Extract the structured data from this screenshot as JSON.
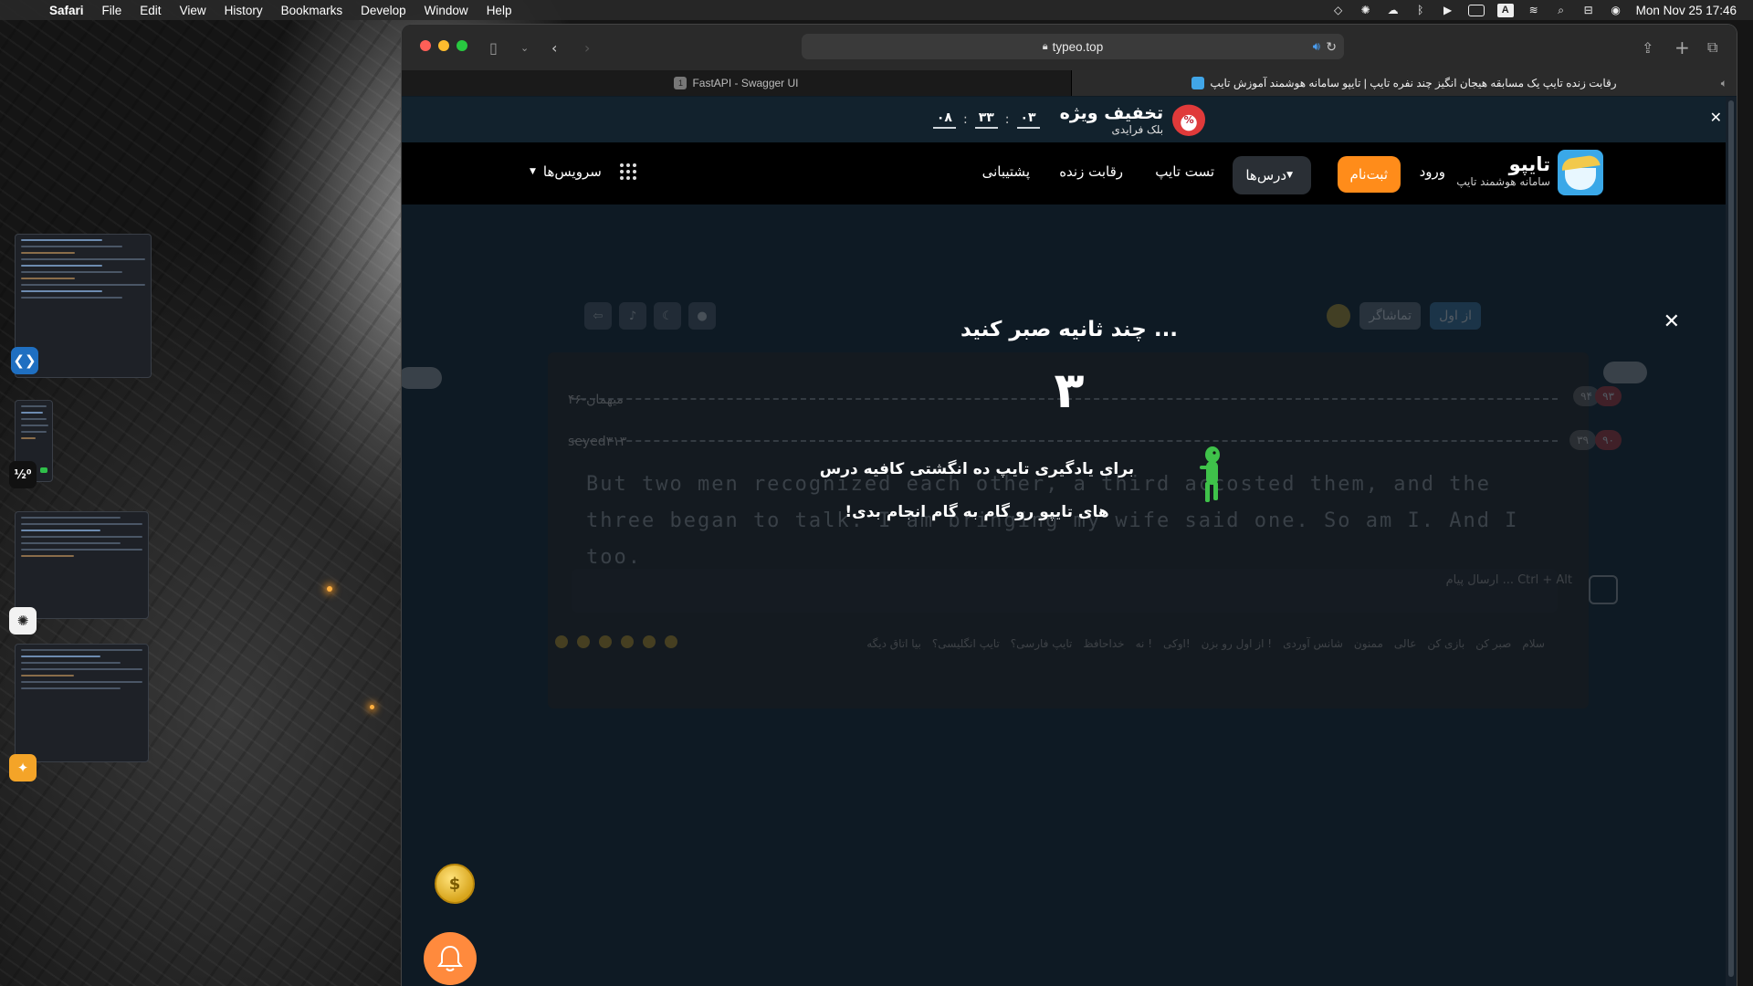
{
  "menubar": {
    "items": [
      "Safari",
      "File",
      "Edit",
      "View",
      "History",
      "Bookmarks",
      "Develop",
      "Window",
      "Help"
    ],
    "status_a": "A",
    "clock": "Mon Nov 25  17:46"
  },
  "dock_side": {
    "badge_text": "½⁰"
  },
  "browser": {
    "url": "typeo.top",
    "tabs": [
      {
        "title": "FastAPI - Swagger UI",
        "favicon": "1"
      },
      {
        "title": "رقابت زنده تایپ یک مسابقه هیجان انگیز چند نفره تایپ | تایپو سامانه هوشمند آموزش تایپ"
      }
    ]
  },
  "promo": {
    "title": "تخفیف ویژه",
    "subtitle": "بلک فرایدی",
    "timer": [
      "۰۸",
      "۳۳",
      "۰۳"
    ],
    "badge": "%"
  },
  "nav": {
    "brand_name": "تایپو",
    "brand_sub": "سامانه هوشمند تایپ",
    "login": "ورود",
    "signup": "ثبت‌نام",
    "lessons": "درس‌ها",
    "typing_test": "تست تایپ",
    "live_race": "رقابت زنده",
    "support": "پشتیبانی",
    "services": "سرویس‌ها"
  },
  "game": {
    "restart": "از اول",
    "spectator": "تماشاگر",
    "racers": [
      {
        "name": "میهمان-۴۶",
        "score": "۹۴",
        "rank": "۹۳"
      },
      {
        "name": "seyed۳۱۳",
        "score": "۳۹",
        "rank": "۹۰"
      }
    ],
    "sentence": "But two men recognized each other, a third accosted them, and the three began to talk. I am bringing my wife said one. So am I. And I too.",
    "chat_placeholder": "ارسال پیام ... Ctrl + Alt",
    "phrases": [
      "سلام",
      "صبر کن",
      "بازی کن",
      "عالی",
      "ممنون",
      "شانس آوردی",
      "از اول رو بزن !",
      "اوکی!",
      "نه !",
      "خداحافظ",
      "تایپ فارسی؟",
      "تایپ انگلیسی؟",
      "بیا اتاق دیگه"
    ]
  },
  "overlay": {
    "title": "چند ثانیه صبر کنید ...",
    "countdown": "۳",
    "tip_line1": "برای یادگیری تایپ ده انگشتی کافیه درس",
    "tip_line2": "های تایپو رو گام به گام انجام بدی!"
  },
  "floating": {
    "coin": "$"
  },
  "colors": {
    "accent_orange": "#ff8c1a",
    "page_bg": "#0e1a24",
    "brand_blue": "#3aa8e8"
  }
}
